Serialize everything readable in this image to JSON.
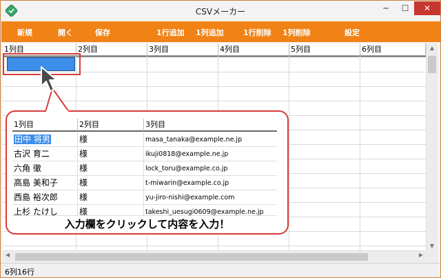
{
  "window": {
    "title": "CSVメーカー",
    "minimize": "─",
    "maximize": "☐",
    "close": "✕"
  },
  "menu": [
    {
      "label": "新規",
      "name": "menu-new"
    },
    {
      "label": "開く",
      "name": "menu-open"
    },
    {
      "label": "保存",
      "name": "menu-save"
    },
    {
      "label": "1行追加",
      "name": "menu-add-row"
    },
    {
      "label": "1列追加",
      "name": "menu-add-col"
    },
    {
      "label": "1行削除",
      "name": "menu-delete-row"
    },
    {
      "label": "1列削除",
      "name": "menu-delete-col"
    },
    {
      "label": "設定",
      "name": "menu-settings"
    }
  ],
  "grid": {
    "columns": [
      "1列目",
      "2列目",
      "3列目",
      "4列目",
      "5列目",
      "6列目"
    ]
  },
  "callout": {
    "headers": [
      "1列目",
      "2列目",
      "3列目"
    ],
    "rows": [
      [
        "田中 将男",
        "様",
        "masa_tanaka@example.ne.jp"
      ],
      [
        "古沢 育二",
        "様",
        "ikuji0818@example.ne.jp"
      ],
      [
        "六角 徹",
        "様",
        "lock_toru@example.co.jp"
      ],
      [
        "高島 美和子",
        "様",
        "t-miwarin@example.co.jp"
      ],
      [
        "西島 裕次郎",
        "様",
        "yu-jiro-nishi@example.com"
      ],
      [
        "上杉 たけし",
        "様",
        "takeshi_uesugi0609@example.ne.jp"
      ]
    ],
    "caption": "入力欄をクリックして内容を入力！"
  },
  "status": {
    "text": "6列16行"
  },
  "colors": {
    "accent": "#f08216",
    "selection": "#3d8ee8",
    "highlight": "#d83a3a"
  }
}
